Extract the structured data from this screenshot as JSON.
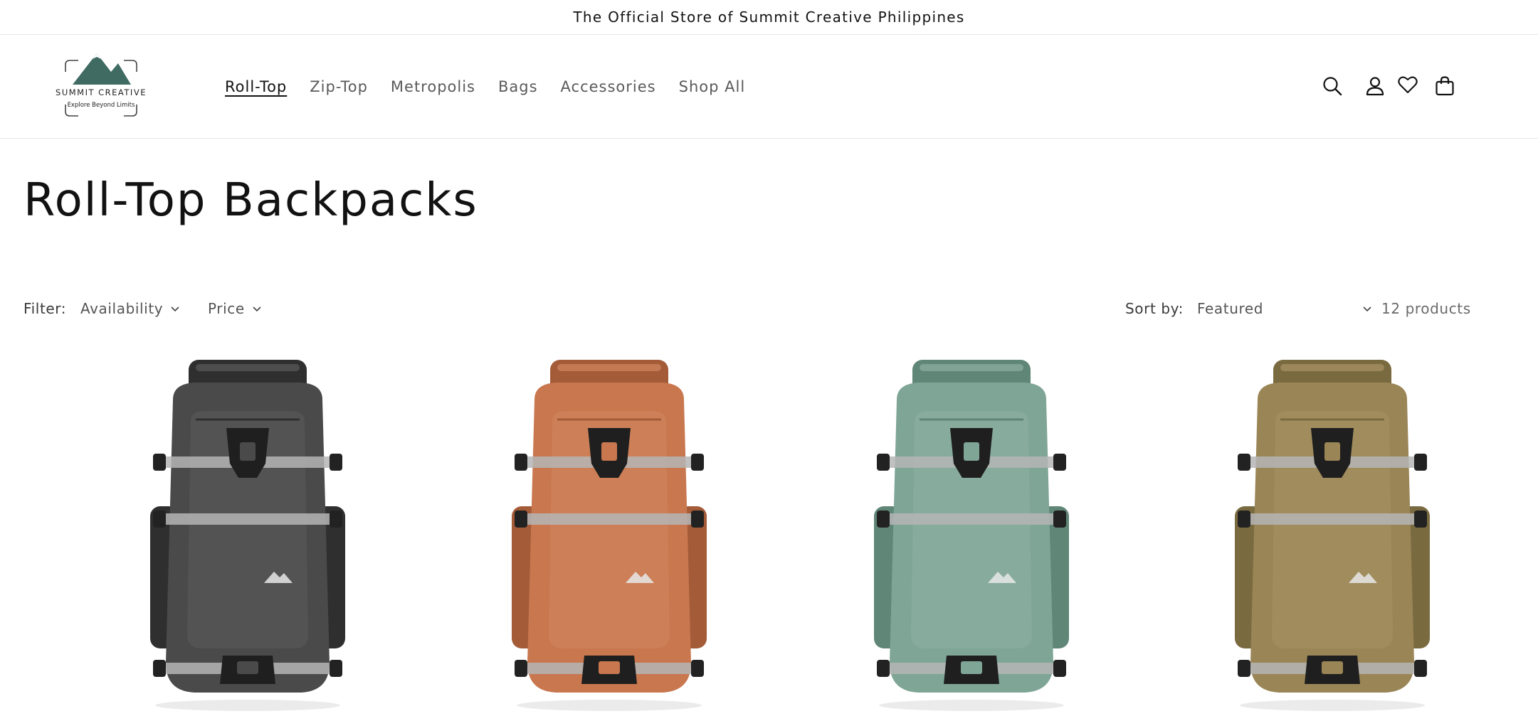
{
  "announcement": {
    "text": "The Official Store of Summit Creative Philippines"
  },
  "logo": {
    "brand": "SUMMIT CREATIVE",
    "tagline": "Explore Beyond Limits"
  },
  "nav": {
    "items": [
      {
        "label": "Roll-Top",
        "active": true
      },
      {
        "label": "Zip-Top",
        "active": false
      },
      {
        "label": "Metropolis",
        "active": false
      },
      {
        "label": "Bags",
        "active": false
      },
      {
        "label": "Accessories",
        "active": false
      },
      {
        "label": "Shop All",
        "active": false
      }
    ]
  },
  "header_icons": [
    "search-icon",
    "account-icon",
    "wishlist-heart-icon",
    "cart-icon"
  ],
  "page": {
    "title": "Roll-Top Backpacks"
  },
  "filters": {
    "label": "Filter:",
    "availability": "Availability",
    "price": "Price",
    "sort_label": "Sort by:",
    "sort_value": "Featured",
    "count": "12 products"
  },
  "products": [
    {
      "color_name": "black",
      "body": "#4a4a4a",
      "shade": "#2f2f2f",
      "light": "#636363"
    },
    {
      "color_name": "orange",
      "body": "#c8774f",
      "shade": "#a35b38",
      "light": "#d88e66"
    },
    {
      "color_name": "green",
      "body": "#7fa596",
      "shade": "#5f8677",
      "light": "#98b8ab"
    },
    {
      "color_name": "khaki",
      "body": "#9a8556",
      "shade": "#7a6a40",
      "light": "#b09b6a"
    }
  ],
  "colors": {
    "logo_green": "#3f6b62",
    "text": "#121212",
    "muted": "#5a5a5a"
  }
}
